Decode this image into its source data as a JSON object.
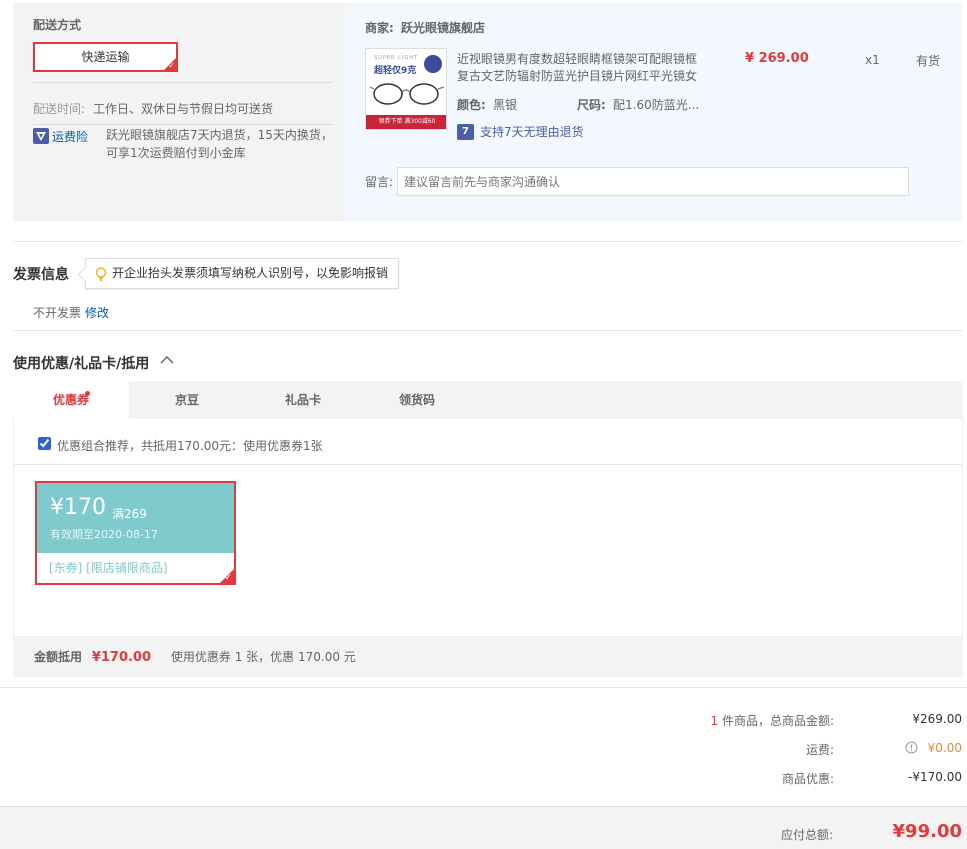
{
  "shipping": {
    "title": "配送方式",
    "method": "快递运输",
    "time_label": "配送时间:",
    "time_value": "工作日、双休日与节假日均可送货",
    "insurance_label": "运费险",
    "insurance_text_1": "跃光眼镜旗舰店7天内退货，15天内换货，",
    "insurance_text_2": "可享1次运费赔付到小金库"
  },
  "shop": {
    "merchant_label": "商家:",
    "merchant_name": "跃光眼镜旗舰店",
    "product": {
      "title_line1": "近视眼镜男有度数超轻眼睛框镜架可配眼镜框",
      "title_line2": "复古文艺防辐射防蓝光护目镜片网红平光镜女",
      "price": "¥ 269.00",
      "qty": "x1",
      "stock": "有货",
      "color_label": "颜色:",
      "color_value": "黑银",
      "size_label": "尺码:",
      "size_value": "配1.60防蓝光...",
      "return_policy": "支持7天无理由退货",
      "return_badge": "7",
      "img_top_text": "SUPER LIGHT",
      "img_main_text": "超轻仅9克",
      "img_bottom_text": "领券下单 满300减60"
    },
    "remark_label": "留言:",
    "remark_placeholder": "建议留言前先与商家沟通确认"
  },
  "invoice": {
    "title": "发票信息",
    "tip": "开企业抬头发票须填写纳税人识别号，以免影响报销",
    "status": "不开发票",
    "edit": "修改"
  },
  "discount": {
    "title": "使用优惠/礼品卡/抵用",
    "tabs": [
      {
        "label": "优惠券"
      },
      {
        "label": "京豆"
      },
      {
        "label": "礼品卡"
      },
      {
        "label": "领货码"
      }
    ],
    "combo_text": "优惠组合推荐，共抵用170.00元：使用优惠券1张",
    "coupon": {
      "amount": "¥170",
      "condition": "满269",
      "validity": "有效期至2020-08-17",
      "tags": "[东券]  [限店铺限商品]"
    },
    "summary_label": "金额抵用",
    "summary_amount": "¥170.00",
    "summary_text": "使用优惠券 1 张，优惠 170.00 元"
  },
  "totals": {
    "count": "1",
    "count_suffix": "件商品，总商品金额:",
    "goods_total": "¥269.00",
    "shipping_label": "运费:",
    "shipping_value": "¥0.00",
    "discount_label": "商品优惠:",
    "discount_value": "-¥170.00",
    "payable_label": "应付总额:",
    "payable_value": "¥99.00"
  },
  "colors": {
    "accent": "#e4393c",
    "coupon": "#7ecacc",
    "link": "#005ea7",
    "orange": "#e4893c"
  }
}
